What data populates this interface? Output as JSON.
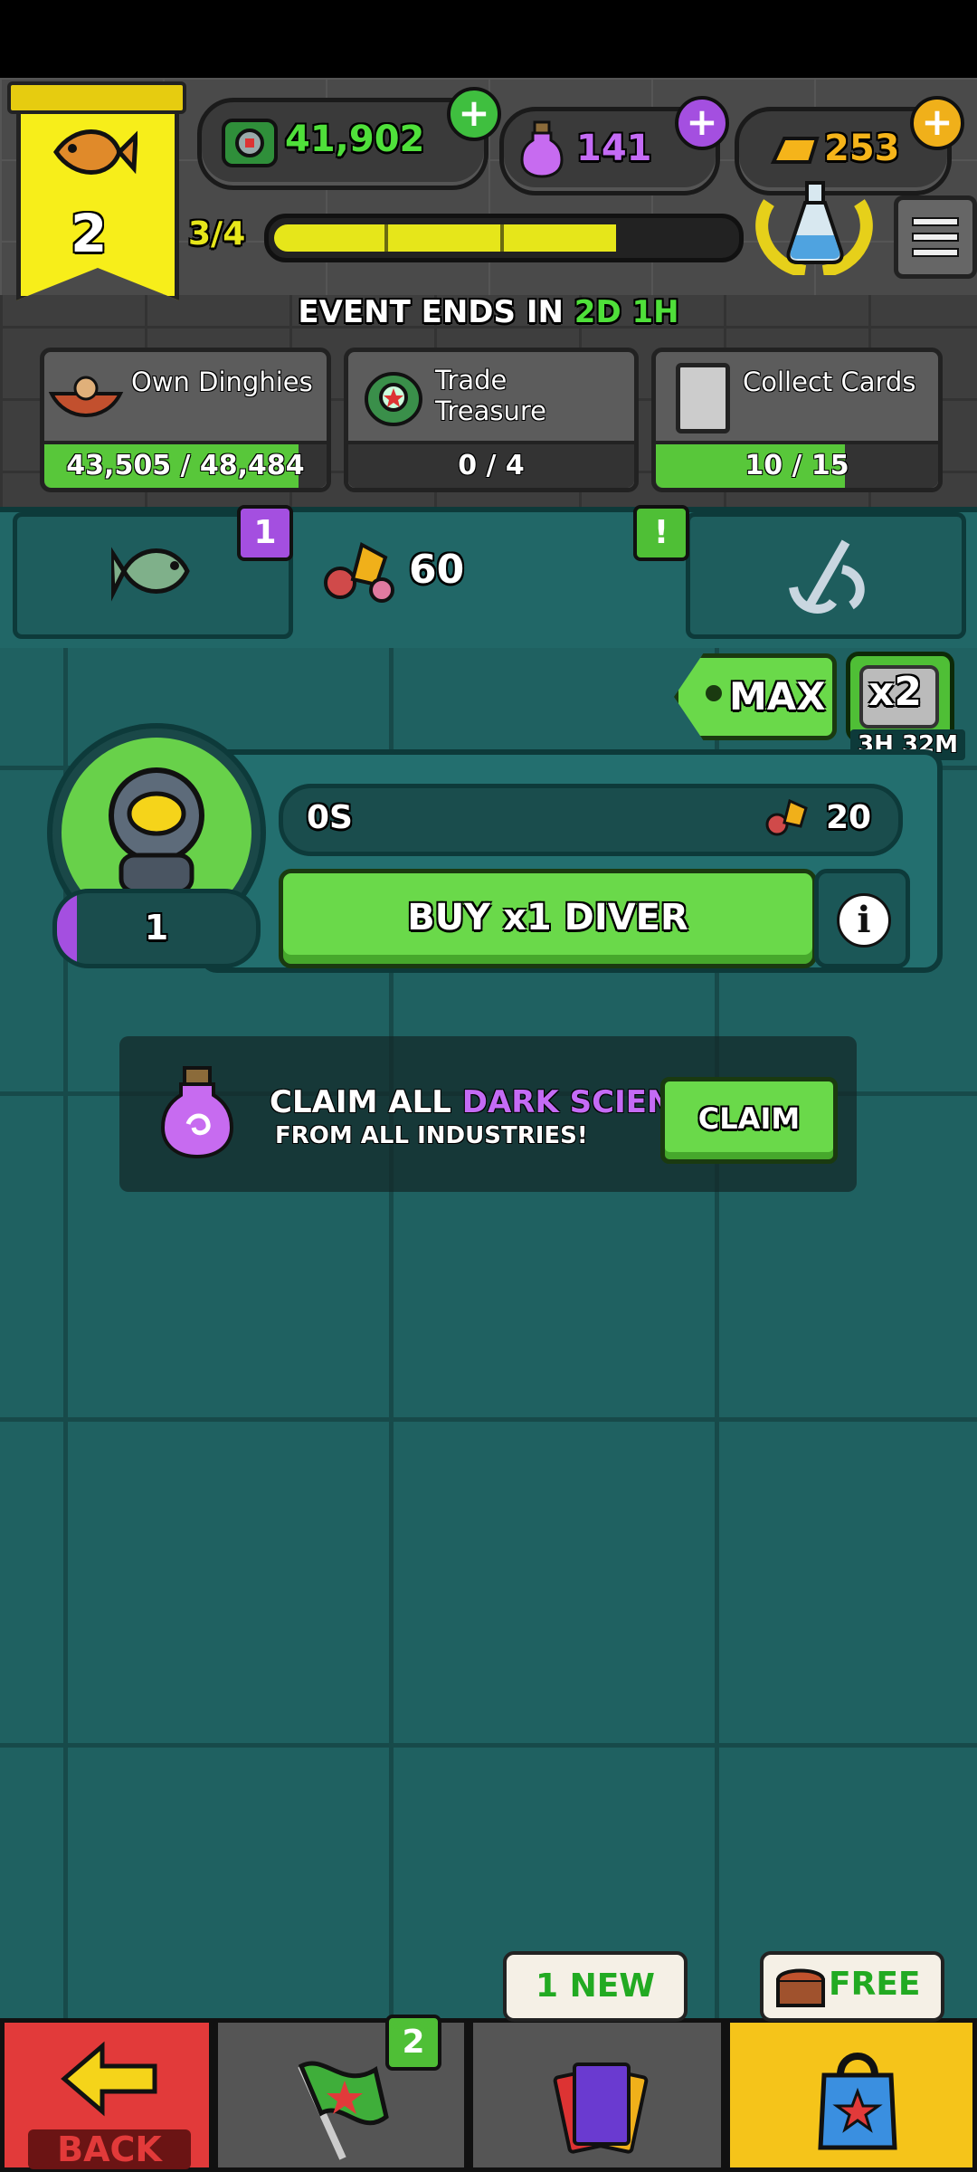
{
  "currencies": {
    "cash": "41,902",
    "dark_science": "141",
    "gold": "253",
    "plus_symbol": "+"
  },
  "player": {
    "level": "2",
    "xp_progress_text": "3/4",
    "xp_fraction": 0.75
  },
  "event": {
    "ends_prefix": "EVENT ENDS IN",
    "ends_value": "2D 1H",
    "objectives": [
      {
        "label": "Own Dinghies",
        "progress": "43,505 / 48,484",
        "fraction": 0.897,
        "icon": "boat-icon"
      },
      {
        "label_line1": "Trade",
        "label_line2": "Treasure",
        "progress": "0 / 4",
        "fraction": 0.0,
        "icon": "diving-helmet-icon"
      },
      {
        "label": "Collect Cards",
        "progress": "10 / 15",
        "fraction": 0.667,
        "icon": "card-icon"
      }
    ]
  },
  "tabs": {
    "fish_badge": "1",
    "gems_count": "60",
    "anchor_badge": "!"
  },
  "industry": {
    "max_label": "MAX",
    "boost_label": "x2",
    "boost_timer": "3H 32M",
    "timer": "0S",
    "yield": "20",
    "owned": "1",
    "buy_label": "BUY x1 DIVER",
    "info_label": "i"
  },
  "claim_all": {
    "line1_prefix": "CLAIM ALL",
    "line1_highlight": "DARK SCIENCE",
    "line2": "FROM ALL INDUSTRIES!",
    "button": "CLAIM"
  },
  "bottom_nav": {
    "back_label": "BACK",
    "flag_badge": "2",
    "cards_bubble": "1 NEW",
    "shop_bubble": "FREE"
  },
  "colors": {
    "green_accent": "#6ad94a",
    "purple_accent": "#b04fe0",
    "yellow_accent": "#f7ee1a",
    "teal_bg": "#1f6161"
  }
}
